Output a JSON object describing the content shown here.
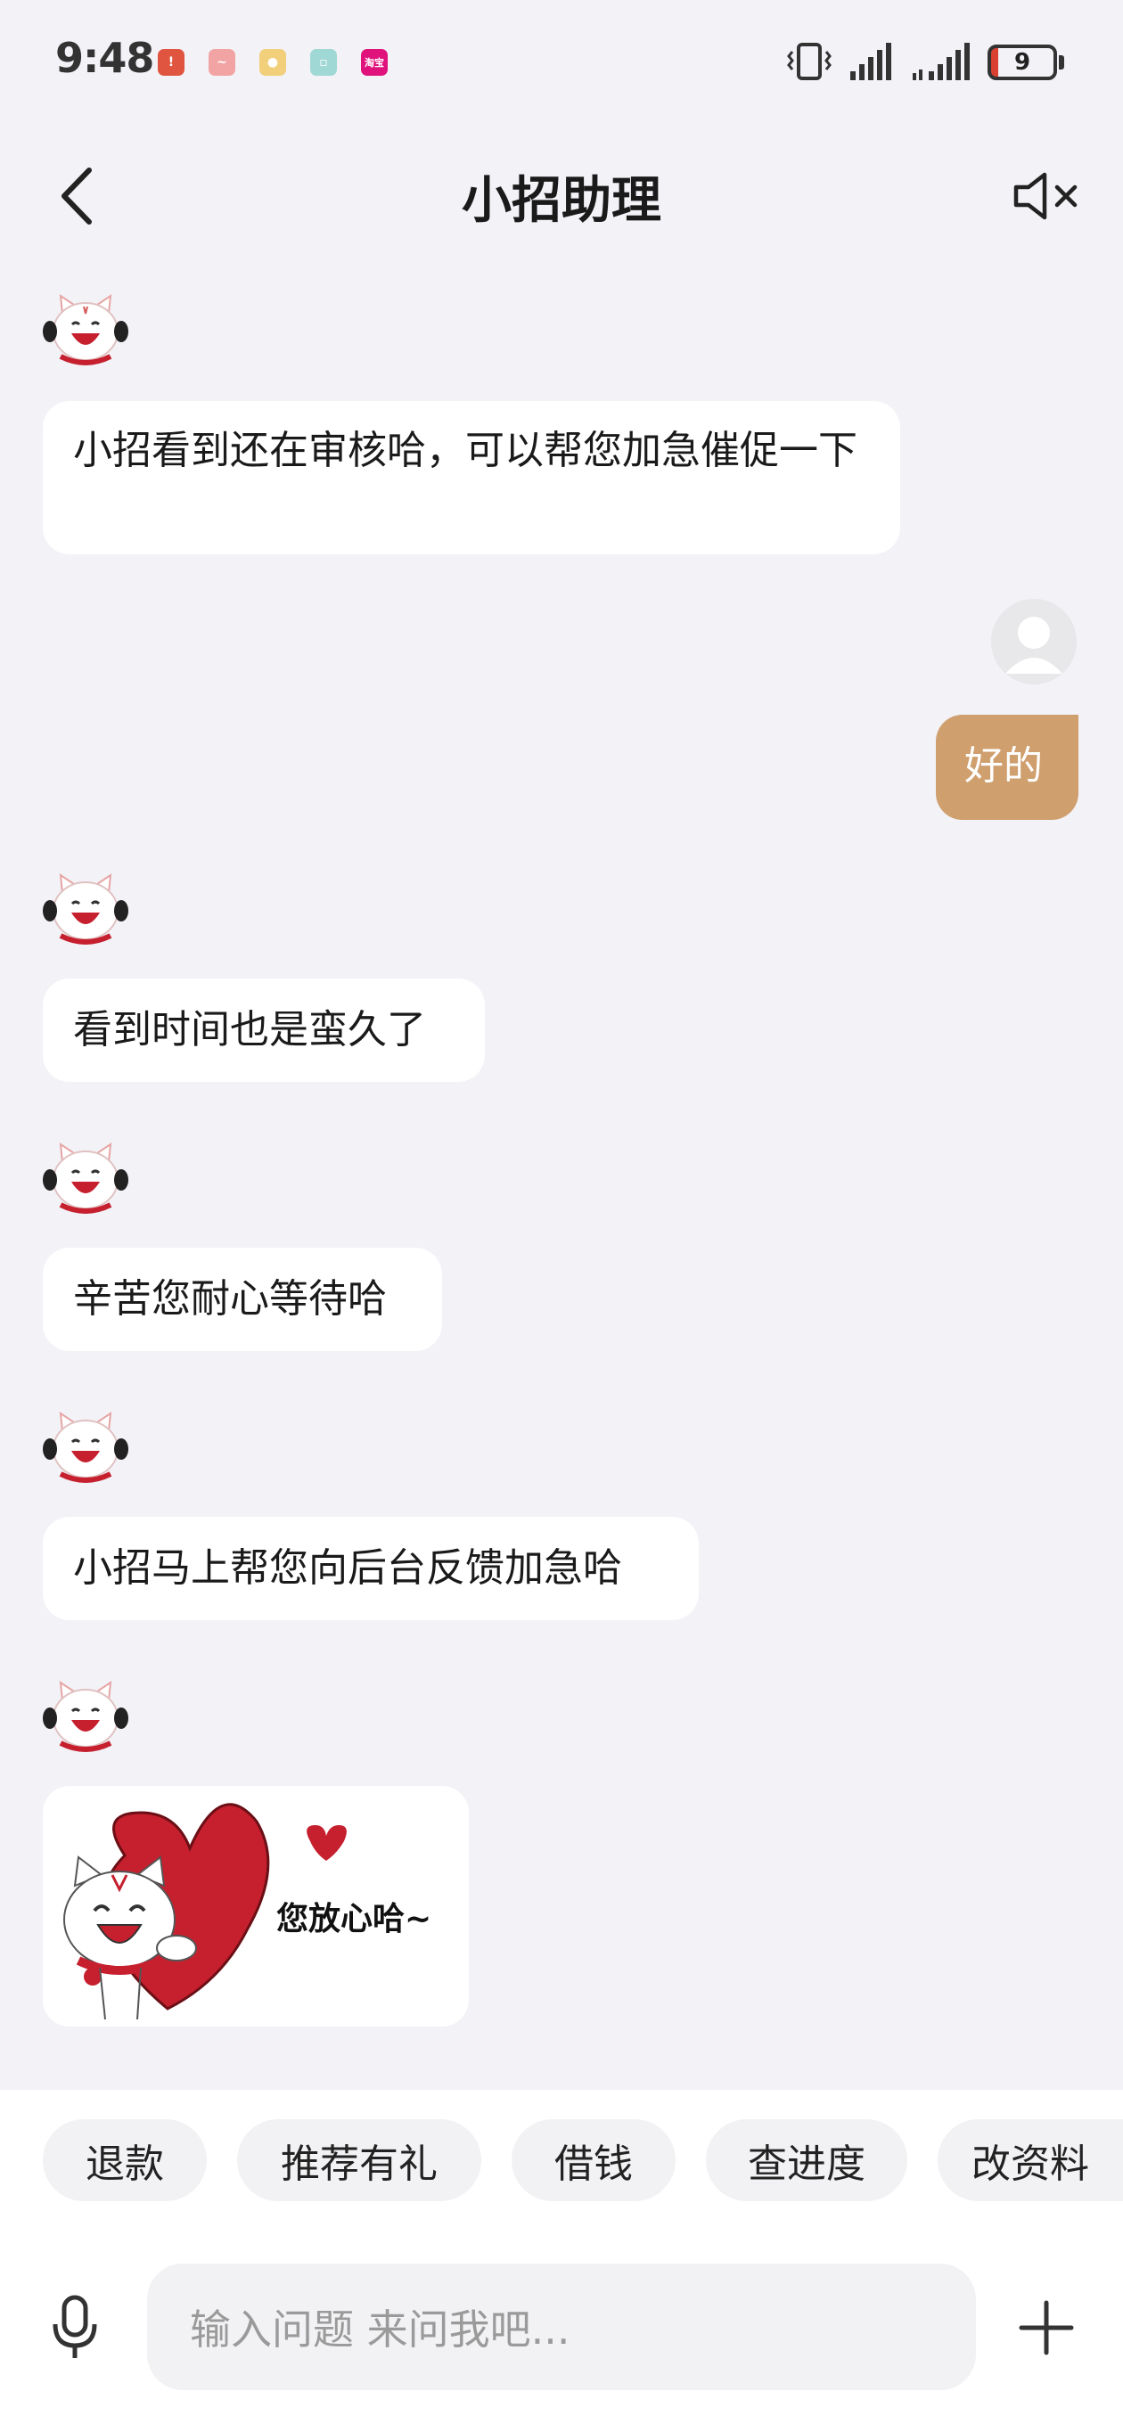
{
  "status_bar": {
    "time": "9:48",
    "battery_level": "9",
    "notification_icons": [
      "app-notification-icon",
      "wave-app-icon",
      "contact-app-icon",
      "photo-app-icon",
      "shopping-app-icon"
    ],
    "notification_label_5": "淘宝"
  },
  "header": {
    "title": "小招助理",
    "back_icon": "chevron-left-icon",
    "mute_icon": "speaker-mute-icon"
  },
  "messages": [
    {
      "sender": "bot",
      "text": "小招看到还在审核哈，可以帮您加急催促一下"
    },
    {
      "sender": "user",
      "text": "好的"
    },
    {
      "sender": "bot",
      "text": "看到时间也是蛮久了"
    },
    {
      "sender": "bot",
      "text": "辛苦您耐心等待哈"
    },
    {
      "sender": "bot",
      "text": "小招马上帮您向后台反馈加急哈"
    },
    {
      "sender": "bot",
      "type": "sticker",
      "text": "您放心哈~"
    }
  ],
  "quick_replies": [
    "退款",
    "推荐有礼",
    "借钱",
    "查进度",
    "改资料"
  ],
  "input": {
    "placeholder": "输入问题 来问我吧...",
    "mic_icon": "microphone-icon",
    "add_icon": "plus-icon"
  },
  "colors": {
    "background": "#f2f2f7",
    "user_bubble": "#cf9f6e",
    "bot_bubble": "#ffffff",
    "brand_red": "#c61f2e"
  }
}
